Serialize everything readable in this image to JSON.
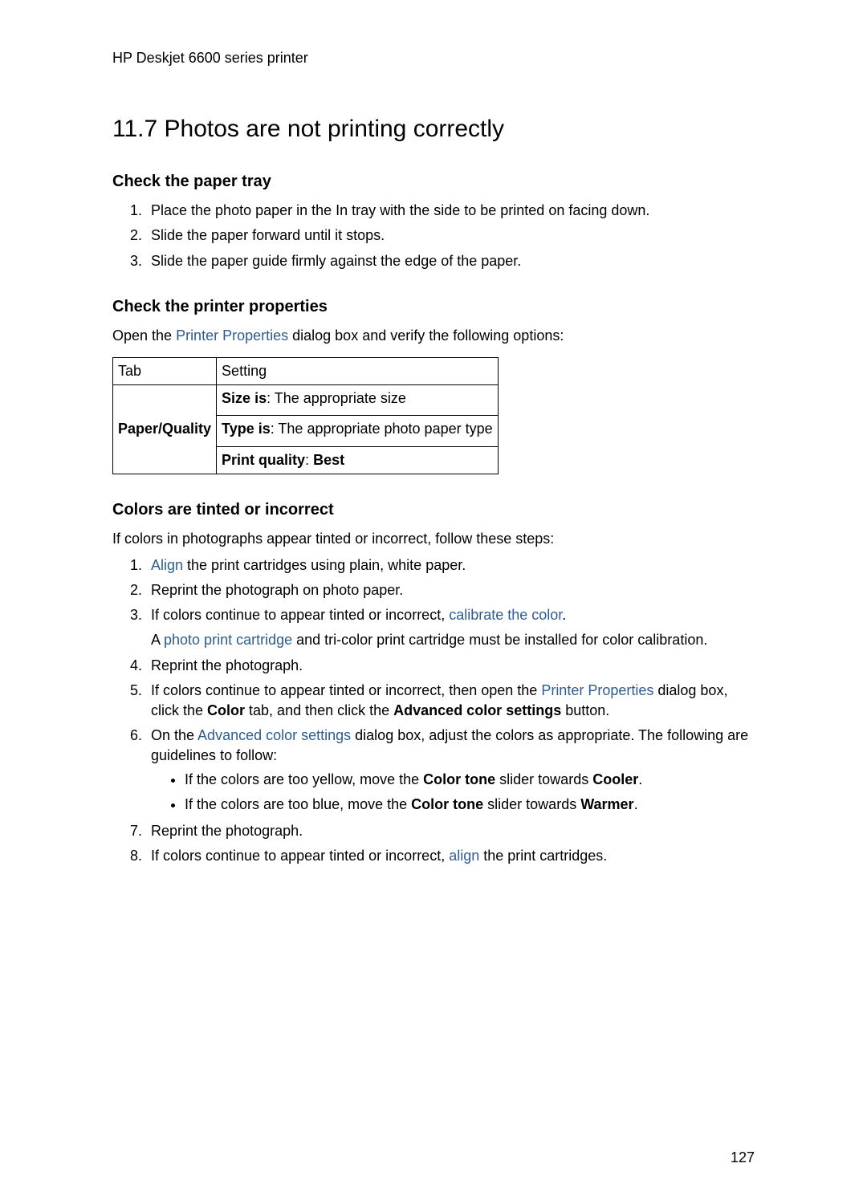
{
  "header": "HP Deskjet 6600 series printer",
  "title": "11.7  Photos are not printing correctly",
  "page_number": "127",
  "sec1": {
    "heading": "Check the paper tray",
    "items": [
      "Place the photo paper in the In tray with the side to be printed on facing down.",
      "Slide the paper forward until it stops.",
      "Slide the paper guide firmly against the edge of the paper."
    ]
  },
  "sec2": {
    "heading": "Check the printer properties",
    "intro_pre": "Open the ",
    "intro_link": "Printer Properties",
    "intro_post": " dialog box and verify the following options:",
    "table": {
      "head_tab": "Tab",
      "head_setting": "Setting",
      "tab_value": "Paper/Quality",
      "row1_label": "Size is",
      "row1_val": ": The appropriate size",
      "row2_label": "Type is",
      "row2_val": ": The appropriate photo paper type",
      "row3_label": "Print quality",
      "row3_sep": ": ",
      "row3_val": "Best"
    }
  },
  "sec3": {
    "heading": "Colors are tinted or incorrect",
    "intro": "If colors in photographs appear tinted or incorrect, follow these steps:",
    "i1_link": "Align",
    "i1_post": " the print cartridges using plain, white paper.",
    "i2": "Reprint the photograph on photo paper.",
    "i3_pre": "If colors continue to appear tinted or incorrect, ",
    "i3_link": "calibrate the color",
    "i3_post": ".",
    "i3p_pre": "A ",
    "i3p_link": "photo print cartridge",
    "i3p_post": " and tri-color print cartridge must be installed for color calibration.",
    "i4": "Reprint the photograph.",
    "i5_pre": "If colors continue to appear tinted or incorrect, then open the ",
    "i5_link": "Printer Properties",
    "i5_mid1": " dialog box, click the ",
    "i5_b1": "Color",
    "i5_mid2": " tab, and then click the ",
    "i5_b2": "Advanced color settings",
    "i5_post": " button.",
    "i6_pre": "On the ",
    "i6_link": "Advanced color settings",
    "i6_post": " dialog box, adjust the colors as appropriate. The following are guidelines to follow:",
    "i6_b1_pre": "If the colors are too yellow, move the ",
    "i6_b1_b1": "Color tone",
    "i6_b1_mid": " slider towards ",
    "i6_b1_b2": "Cooler",
    "i6_b1_post": ".",
    "i6_b2_pre": "If the colors are too blue, move the ",
    "i6_b2_b1": "Color tone",
    "i6_b2_mid": " slider towards ",
    "i6_b2_b2": "Warmer",
    "i6_b2_post": ".",
    "i7": "Reprint the photograph.",
    "i8_pre": "If colors continue to appear tinted or incorrect, ",
    "i8_link": "align",
    "i8_post": " the print cartridges."
  }
}
